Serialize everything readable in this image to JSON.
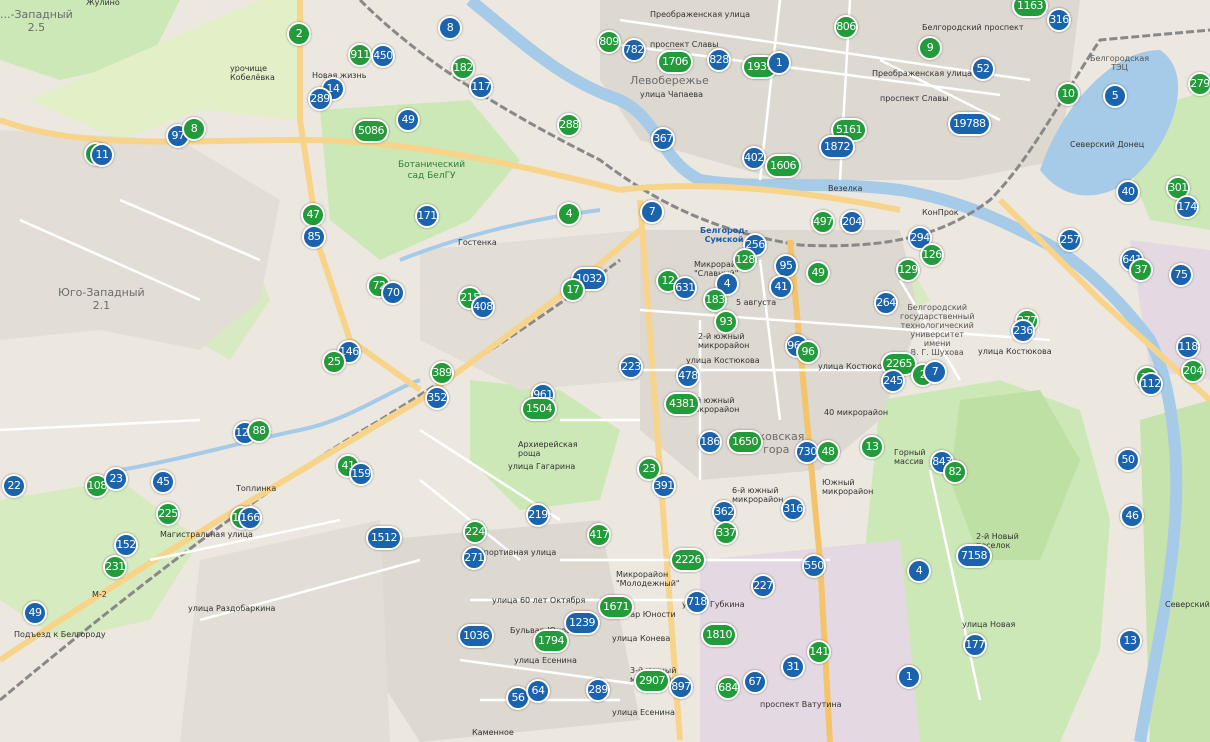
{
  "map": {
    "district_labels": [
      {
        "id": "zapadny-25",
        "text": "...-Западный\n2.5"
      },
      {
        "id": "yugo-zapadny-21",
        "text": "Юго-Западный\n2.1"
      },
      {
        "id": "zhulino",
        "text": "Жулино"
      },
      {
        "id": "levoberezhye",
        "text": "Левобережье"
      },
      {
        "id": "arkhiereyskaya",
        "text": "Архиерейская\nроща"
      },
      {
        "id": "harkovskaya",
        "text": "...ковская\nгора"
      },
      {
        "id": "urochishche",
        "text": "урочище\nКобелёвка"
      },
      {
        "id": "novaya-zhizn",
        "text": "Новая жизнь"
      },
      {
        "id": "bot-sad",
        "text": "Ботанический\nсад БелГУ"
      },
      {
        "id": "mkr-slavny",
        "text": "Микрорайон\n\"Славный\""
      },
      {
        "id": "mkr-40",
        "text": "40 микрорайон"
      },
      {
        "id": "mkr-3yuzh",
        "text": "3-й южный\nмикрорайон"
      },
      {
        "id": "mkr-2yuzh",
        "text": "2-й южный\nмикрорайон"
      },
      {
        "id": "mkr-6yuzh",
        "text": "6-й южный\nмикрорайон"
      },
      {
        "id": "mkr-yuzhny",
        "text": "Южный\nмикрорайон"
      },
      {
        "id": "gorny",
        "text": "Горный\nмассив"
      },
      {
        "id": "mkr-molodezhny",
        "text": "Микрорайон\n\"Молодежный\""
      },
      {
        "id": "mkr-3yuzh2",
        "text": "3-й южный\nмикрорайон"
      },
      {
        "id": "uni",
        "text": "Белгородский\nгосударственный\nтехнологический\nуниверситет\nимени\nВ. Г. Шухова"
      },
      {
        "id": "tec",
        "text": "Белгородская\nТЭЦ"
      },
      {
        "id": "station",
        "text": "Белгород-\nСумской"
      },
      {
        "id": "seversky1",
        "text": "Северский Донец"
      },
      {
        "id": "seversky2",
        "text": "Северский Донец"
      },
      {
        "id": "m2",
        "text": "М-2"
      }
    ],
    "street_labels": [
      {
        "id": "preobrazhenskaya1",
        "text": "Преображенская улица"
      },
      {
        "id": "slavy1",
        "text": "проспект Славы"
      },
      {
        "id": "belgorodsky",
        "text": "Белгородский проспект"
      },
      {
        "id": "preobrazhenskaya2",
        "text": "Преображенская улица"
      },
      {
        "id": "slavy2",
        "text": "проспект Славы"
      },
      {
        "id": "chapaeva",
        "text": "улица Чапаева"
      },
      {
        "id": "kostyukova1",
        "text": "улица Костюкова"
      },
      {
        "id": "kostyukova2",
        "text": "улица Костюкова"
      },
      {
        "id": "kostyukova3",
        "text": "улица Костюкова"
      },
      {
        "id": "avgusta",
        "text": "5 августа"
      },
      {
        "id": "magistral",
        "text": "Магистральная улица"
      },
      {
        "id": "razdobarkina",
        "text": "улица Раздобаркина"
      },
      {
        "id": "oktyabr",
        "text": "улица 60 лет Октября"
      },
      {
        "id": "yunosti",
        "text": "бульвар Юности"
      },
      {
        "id": "yunosti2",
        "text": "Бульвар Юности"
      },
      {
        "id": "koneva",
        "text": "улица Конева"
      },
      {
        "id": "esenina1",
        "text": "улица Есенина"
      },
      {
        "id": "esenina2",
        "text": "улица Есенина"
      },
      {
        "id": "vatutina",
        "text": "проспект Ватутина"
      },
      {
        "id": "gubkina",
        "text": "улица Губкина"
      },
      {
        "id": "sportivnaya",
        "text": "Спортивная улица"
      },
      {
        "id": "gagarina",
        "text": "улица Гагарина"
      },
      {
        "id": "novaya",
        "text": "улица Новая"
      },
      {
        "id": "kamennoe",
        "text": "Каменное"
      },
      {
        "id": "podezd",
        "text": "Подъезд к Белгороду"
      },
      {
        "id": "vezelka",
        "text": "Везелка"
      },
      {
        "id": "gostenka",
        "text": "Гостенка"
      },
      {
        "id": "topolnka",
        "text": "Топлинка"
      },
      {
        "id": "konprok",
        "text": "КонПрок"
      },
      {
        "id": "2noviy",
        "text": "2-й Новый\nпоселок"
      }
    ],
    "markers": [
      {
        "label": "2",
        "color": "green"
      },
      {
        "label": "8",
        "color": "blue"
      },
      {
        "label": "911",
        "color": "green"
      },
      {
        "label": "450",
        "color": "blue"
      },
      {
        "label": "182",
        "color": "green"
      },
      {
        "label": "117",
        "color": "blue"
      },
      {
        "label": "809",
        "color": "green"
      },
      {
        "label": "782",
        "color": "blue"
      },
      {
        "label": "1706",
        "color": "green"
      },
      {
        "label": "828",
        "color": "blue"
      },
      {
        "label": "1939",
        "color": "green"
      },
      {
        "label": "1",
        "color": "blue"
      },
      {
        "label": "806",
        "color": "green"
      },
      {
        "label": "9",
        "color": "green"
      },
      {
        "label": "1163",
        "color": "green"
      },
      {
        "label": "316",
        "color": "blue"
      },
      {
        "label": "52",
        "color": "blue"
      },
      {
        "label": "10",
        "color": "green"
      },
      {
        "label": "5",
        "color": "blue"
      },
      {
        "label": "279",
        "color": "green"
      },
      {
        "label": "14",
        "color": "blue"
      },
      {
        "label": "289",
        "color": "blue"
      },
      {
        "label": "49",
        "color": "blue"
      },
      {
        "label": "5086",
        "color": "green"
      },
      {
        "label": "97",
        "color": "blue"
      },
      {
        "label": "8",
        "color": "green"
      },
      {
        "label": "2",
        "color": "green"
      },
      {
        "label": "11",
        "color": "blue"
      },
      {
        "label": "288",
        "color": "green"
      },
      {
        "label": "367",
        "color": "blue"
      },
      {
        "label": "5161",
        "color": "green"
      },
      {
        "label": "1872",
        "color": "blue"
      },
      {
        "label": "19788",
        "color": "blue"
      },
      {
        "label": "402",
        "color": "blue"
      },
      {
        "label": "1606",
        "color": "green"
      },
      {
        "label": "40",
        "color": "blue"
      },
      {
        "label": "301",
        "color": "green"
      },
      {
        "label": "174",
        "color": "blue"
      },
      {
        "label": "47",
        "color": "green"
      },
      {
        "label": "85",
        "color": "blue"
      },
      {
        "label": "171",
        "color": "blue"
      },
      {
        "label": "4",
        "color": "green"
      },
      {
        "label": "7",
        "color": "blue"
      },
      {
        "label": "497",
        "color": "green"
      },
      {
        "label": "204",
        "color": "blue"
      },
      {
        "label": "294",
        "color": "blue"
      },
      {
        "label": "126",
        "color": "green"
      },
      {
        "label": "257",
        "color": "blue"
      },
      {
        "label": "641",
        "color": "blue"
      },
      {
        "label": "37",
        "color": "green"
      },
      {
        "label": "75",
        "color": "blue"
      },
      {
        "label": "256",
        "color": "blue"
      },
      {
        "label": "128",
        "color": "green"
      },
      {
        "label": "95",
        "color": "blue"
      },
      {
        "label": "49",
        "color": "green"
      },
      {
        "label": "129",
        "color": "green"
      },
      {
        "label": "1032",
        "color": "blue"
      },
      {
        "label": "17",
        "color": "green"
      },
      {
        "label": "12",
        "color": "green"
      },
      {
        "label": "631",
        "color": "blue"
      },
      {
        "label": "4",
        "color": "blue"
      },
      {
        "label": "183",
        "color": "green"
      },
      {
        "label": "41",
        "color": "blue"
      },
      {
        "label": "72",
        "color": "green"
      },
      {
        "label": "70",
        "color": "blue"
      },
      {
        "label": "215",
        "color": "green"
      },
      {
        "label": "408",
        "color": "blue"
      },
      {
        "label": "264",
        "color": "blue"
      },
      {
        "label": "277",
        "color": "green"
      },
      {
        "label": "236",
        "color": "blue"
      },
      {
        "label": "93",
        "color": "green"
      },
      {
        "label": "961",
        "color": "blue"
      },
      {
        "label": "96",
        "color": "green"
      },
      {
        "label": "118",
        "color": "blue"
      },
      {
        "label": "2265",
        "color": "green"
      },
      {
        "label": "245",
        "color": "blue"
      },
      {
        "label": "2",
        "color": "green"
      },
      {
        "label": "7",
        "color": "blue"
      },
      {
        "label": "204",
        "color": "green"
      },
      {
        "label": "17",
        "color": "green"
      },
      {
        "label": "112",
        "color": "blue"
      },
      {
        "label": "146",
        "color": "blue"
      },
      {
        "label": "25",
        "color": "green"
      },
      {
        "label": "389",
        "color": "green"
      },
      {
        "label": "352",
        "color": "blue"
      },
      {
        "label": "223",
        "color": "blue"
      },
      {
        "label": "478",
        "color": "blue"
      },
      {
        "label": "961",
        "color": "blue"
      },
      {
        "label": "1504",
        "color": "green"
      },
      {
        "label": "4381",
        "color": "green"
      },
      {
        "label": "126",
        "color": "blue"
      },
      {
        "label": "88",
        "color": "green"
      },
      {
        "label": "186",
        "color": "blue"
      },
      {
        "label": "1650",
        "color": "green"
      },
      {
        "label": "730",
        "color": "blue"
      },
      {
        "label": "48",
        "color": "green"
      },
      {
        "label": "13",
        "color": "green"
      },
      {
        "label": "843",
        "color": "blue"
      },
      {
        "label": "82",
        "color": "green"
      },
      {
        "label": "50",
        "color": "blue"
      },
      {
        "label": "22",
        "color": "blue"
      },
      {
        "label": "108",
        "color": "green"
      },
      {
        "label": "23",
        "color": "blue"
      },
      {
        "label": "45",
        "color": "blue"
      },
      {
        "label": "41",
        "color": "green"
      },
      {
        "label": "159",
        "color": "blue"
      },
      {
        "label": "23",
        "color": "green"
      },
      {
        "label": "391",
        "color": "blue"
      },
      {
        "label": "225",
        "color": "green"
      },
      {
        "label": "166",
        "color": "green"
      },
      {
        "label": "166",
        "color": "blue"
      },
      {
        "label": "219",
        "color": "blue"
      },
      {
        "label": "362",
        "color": "blue"
      },
      {
        "label": "316",
        "color": "blue"
      },
      {
        "label": "337",
        "color": "green"
      },
      {
        "label": "1512",
        "color": "blue"
      },
      {
        "label": "224",
        "color": "green"
      },
      {
        "label": "417",
        "color": "green"
      },
      {
        "label": "46",
        "color": "blue"
      },
      {
        "label": "152",
        "color": "blue"
      },
      {
        "label": "271",
        "color": "blue"
      },
      {
        "label": "2226",
        "color": "green"
      },
      {
        "label": "550",
        "color": "blue"
      },
      {
        "label": "7158",
        "color": "blue"
      },
      {
        "label": "231",
        "color": "green"
      },
      {
        "label": "4",
        "color": "blue"
      },
      {
        "label": "227",
        "color": "blue"
      },
      {
        "label": "49",
        "color": "blue"
      },
      {
        "label": "1671",
        "color": "green"
      },
      {
        "label": "718",
        "color": "blue"
      },
      {
        "label": "1239",
        "color": "blue"
      },
      {
        "label": "1036",
        "color": "blue"
      },
      {
        "label": "1794",
        "color": "green"
      },
      {
        "label": "1810",
        "color": "green"
      },
      {
        "label": "177",
        "color": "blue"
      },
      {
        "label": "13",
        "color": "blue"
      },
      {
        "label": "141",
        "color": "green"
      },
      {
        "label": "31",
        "color": "blue"
      },
      {
        "label": "2907",
        "color": "green"
      },
      {
        "label": "897",
        "color": "blue"
      },
      {
        "label": "684",
        "color": "green"
      },
      {
        "label": "67",
        "color": "blue"
      },
      {
        "label": "1",
        "color": "blue"
      },
      {
        "label": "289",
        "color": "blue"
      },
      {
        "label": "56",
        "color": "blue"
      },
      {
        "label": "64",
        "color": "blue"
      }
    ]
  }
}
